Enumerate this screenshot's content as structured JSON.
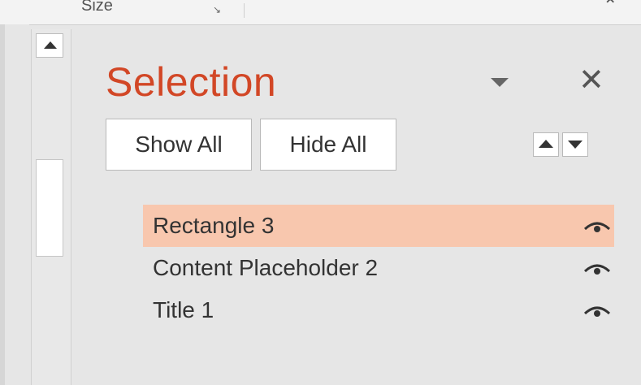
{
  "ribbon": {
    "group_label": "Size"
  },
  "pane": {
    "title": "Selection",
    "show_all_label": "Show All",
    "hide_all_label": "Hide All",
    "items": [
      {
        "label": "Rectangle 3",
        "selected": true
      },
      {
        "label": "Content Placeholder 2",
        "selected": false
      },
      {
        "label": "Title 1",
        "selected": false
      }
    ]
  },
  "colors": {
    "title": "#d24726",
    "selected_row": "#f8c7ae",
    "pane_background": "#e6e6e6"
  },
  "icons": {
    "visibility": "eye-icon",
    "close": "close-icon",
    "dropdown": "chevron-down-icon",
    "bring_forward": "arrow-up-icon",
    "send_backward": "arrow-down-icon"
  }
}
